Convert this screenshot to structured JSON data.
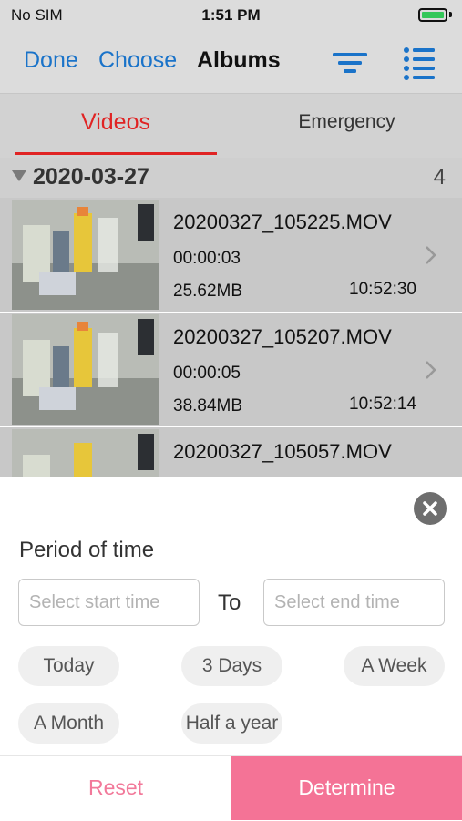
{
  "status": {
    "carrier": "No SIM",
    "time": "1:51 PM",
    "battery_level": 0.85
  },
  "navbar": {
    "done_label": "Done",
    "choose_label": "Choose",
    "title": "Albums",
    "icons": [
      "filter-icon",
      "list-view-icon"
    ],
    "accent_color": "#1a73c9"
  },
  "tabs": [
    {
      "label": "Videos",
      "active": true
    },
    {
      "label": "Emergency",
      "active": false
    }
  ],
  "section": {
    "date": "2020-03-27",
    "count": "4"
  },
  "videos": [
    {
      "name": "20200327_105225.MOV",
      "duration": "00:00:03",
      "size": "25.62MB",
      "time": "10:52:30"
    },
    {
      "name": "20200327_105207.MOV",
      "duration": "00:00:05",
      "size": "38.84MB",
      "time": "10:52:14"
    },
    {
      "name": "20200327_105057.MOV",
      "duration": "",
      "size": "",
      "time": ""
    }
  ],
  "filter": {
    "period_label": "Period of time",
    "start_placeholder": "Select start time",
    "to_label": "To",
    "end_placeholder": "Select end time",
    "quick_ranges": [
      "Today",
      "3 Days",
      "A Week",
      "A Month",
      "Half a year"
    ],
    "reset_label": "Reset",
    "determine_label": "Determine",
    "reset_color": "#f2799a",
    "determine_color": "#f47396"
  }
}
